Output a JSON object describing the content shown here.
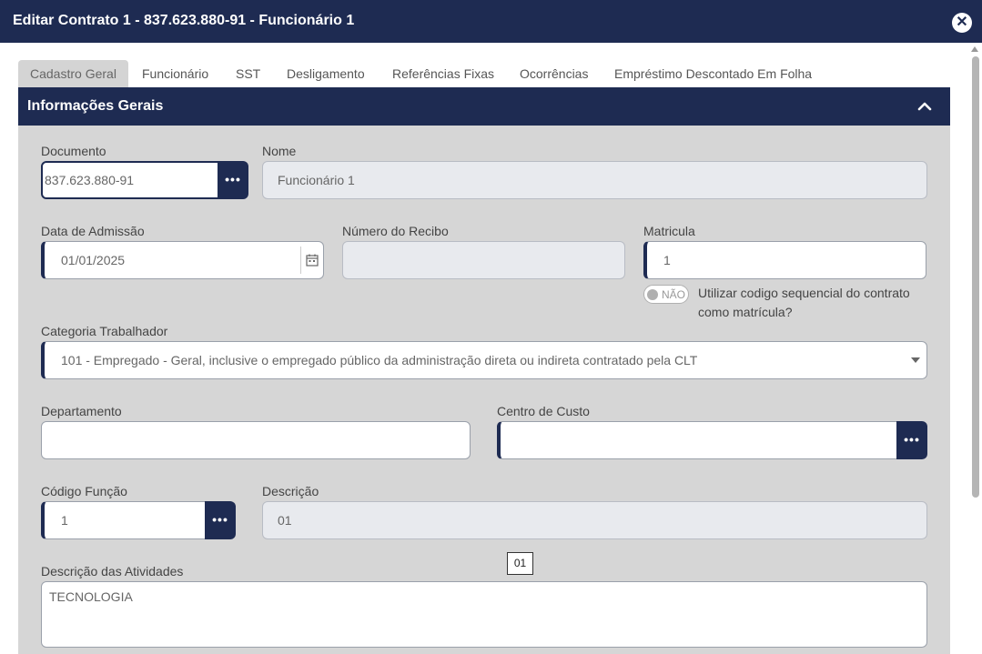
{
  "window": {
    "title": "Editar Contrato 1 - 837.623.880-91 - Funcionário 1",
    "close_glyph": "✕"
  },
  "tabs": [
    {
      "label": "Cadastro Geral",
      "active": true
    },
    {
      "label": "Funcionário"
    },
    {
      "label": "SST"
    },
    {
      "label": "Desligamento"
    },
    {
      "label": "Referências Fixas"
    },
    {
      "label": "Ocorrências"
    },
    {
      "label": "Empréstimo Descontado Em Folha"
    }
  ],
  "section": {
    "title": "Informações Gerais"
  },
  "form": {
    "documento": {
      "label": "Documento",
      "value": "837.623.880-91",
      "lookup_glyph": "•••"
    },
    "nome": {
      "label": "Nome",
      "value": "Funcionário 1"
    },
    "data_admissao": {
      "label": "Data de Admissão",
      "value": "01/01/2025"
    },
    "numero_recibo": {
      "label": "Número do Recibo",
      "value": ""
    },
    "matricula": {
      "label": "Matricula",
      "value": "1"
    },
    "sequencial": {
      "toggle_label": "NÃO",
      "line1": "Utilizar codigo sequencial do contrato",
      "line2": "como matrícula?"
    },
    "categoria": {
      "label": "Categoria Trabalhador",
      "value": "101 - Empregado - Geral, inclusive o empregado público da administração direta ou indireta contratado pela CLT"
    },
    "departamento": {
      "label": "Departamento",
      "value": ""
    },
    "centro_custo": {
      "label": "Centro de Custo",
      "value": "",
      "lookup_glyph": "•••"
    },
    "codigo_funcao": {
      "label": "Código Função",
      "value": "1",
      "lookup_glyph": "•••"
    },
    "descricao": {
      "label": "Descrição",
      "value": "01"
    },
    "tooltip": "01",
    "descricao_atividades": {
      "label": "Descrição das Atividades",
      "value": "TECNOLOGIA"
    }
  },
  "colors": {
    "primary": "#1e2b52",
    "panel_bg": "#d6d6d6",
    "readonly_bg": "#e8eaee"
  }
}
